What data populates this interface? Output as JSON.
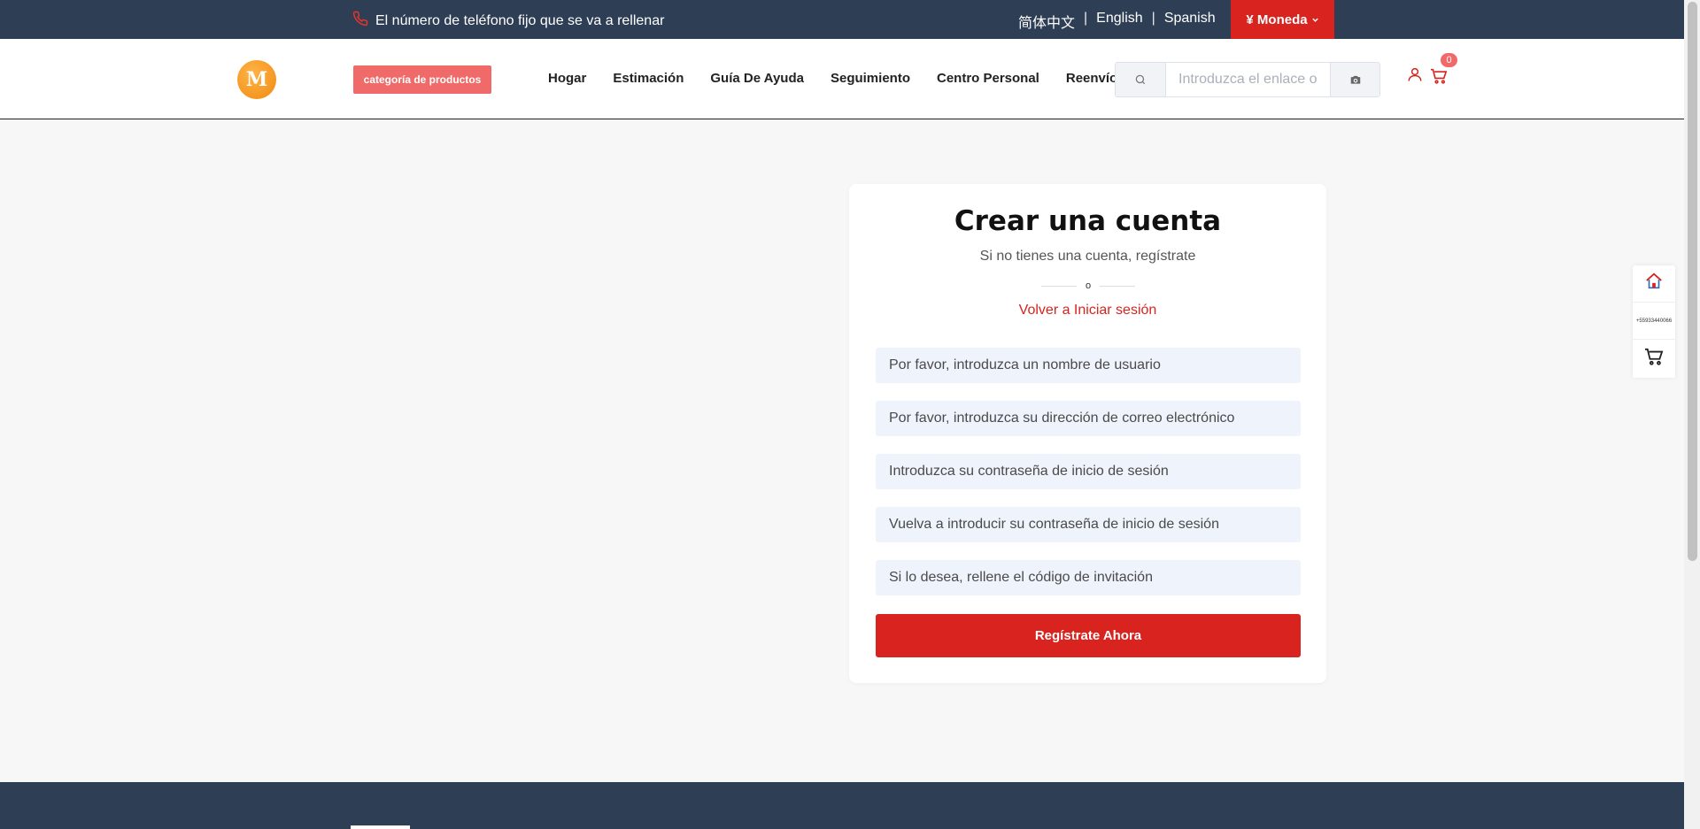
{
  "topbar": {
    "phone_text": "El número de teléfono fijo que se va a rellenar",
    "languages": [
      "简体中文",
      "English",
      "Spanish"
    ],
    "currency_label": "¥ Moneda"
  },
  "header": {
    "logo_letter": "M",
    "category_button": "categoría de productos",
    "nav": [
      "Hogar",
      "Estimación",
      "Guía De Ayuda",
      "Seguimiento",
      "Centro Personal",
      "Reenvío"
    ],
    "search_placeholder": "Introduzca el enlace o",
    "cart_count": "0"
  },
  "register": {
    "title": "Crear una cuenta",
    "subtitle": "Si no tienes una cuenta, regístrate",
    "divider": "o",
    "back_link": "Volver a Iniciar sesión",
    "fields": {
      "username": "Por favor, introduzca un nombre de usuario",
      "email": "Por favor, introduzca su dirección de correo electrónico",
      "password": "Introduzca su contraseña de inicio de sesión",
      "password_confirm": "Vuelva a introducir su contraseña de inicio de sesión",
      "invite_code": "Si lo desea, rellene el código de invitación"
    },
    "submit": "Regístrate Ahora"
  },
  "side_widget": {
    "phone_number": "+55933440066"
  },
  "colors": {
    "topbar_bg": "#2e3e55",
    "accent_red": "#d8231e",
    "category_button_bg": "#f06a6a",
    "field_bg": "#eef3fc"
  },
  "icons": [
    "phone-icon",
    "chevron-down-icon",
    "logo-icon",
    "search-icon",
    "camera-icon",
    "user-icon",
    "cart-icon",
    "home-icon"
  ]
}
